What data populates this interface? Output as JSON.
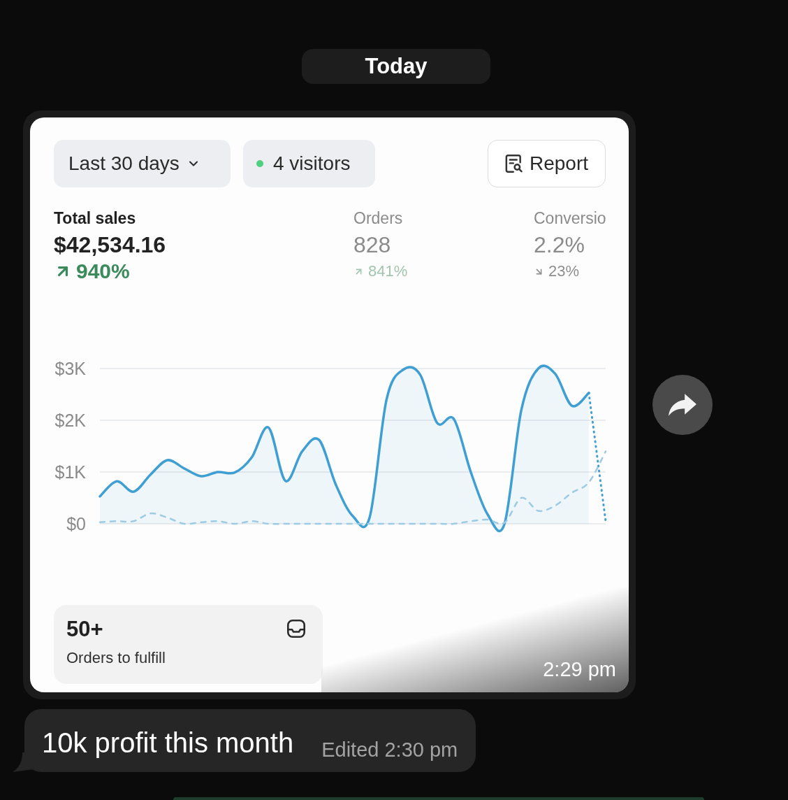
{
  "date_divider": "Today",
  "image_message": {
    "filters": [
      {
        "kind": "dropdown",
        "label": "Last 30 days"
      },
      {
        "kind": "live",
        "label": "4 visitors"
      }
    ],
    "report_button": {
      "label": "Report"
    },
    "metrics": [
      {
        "label": "Total sales",
        "value": "$42,534.16",
        "change": "940%",
        "rising": true,
        "selected": true
      },
      {
        "label": "Orders",
        "value": "828",
        "change": "841%",
        "rising": true,
        "selected": false
      },
      {
        "label": "Conversio",
        "value": "2.2%",
        "change": "23%",
        "rising": false,
        "selected": false
      }
    ],
    "chart_data": {
      "type": "line",
      "grid": true,
      "ylim": [
        0,
        3000
      ],
      "yticks": [
        {
          "value": 0,
          "label": "$0"
        },
        {
          "value": 1000,
          "label": "$1K"
        },
        {
          "value": 2000,
          "label": "$2K"
        },
        {
          "value": 3000,
          "label": "$3K"
        }
      ],
      "series": [
        {
          "type": "area",
          "color": "#3f9fd2",
          "line_style": "solid",
          "values": [
            530,
            820,
            620,
            950,
            1230,
            1070,
            920,
            1000,
            990,
            1280,
            1860,
            830,
            1400,
            1620,
            750,
            150,
            120,
            2400,
            2980,
            2880,
            1950,
            2020,
            1000,
            180,
            0,
            2200,
            3000,
            2900,
            2280,
            2530,
            null
          ]
        },
        {
          "type": "line",
          "color": "#3f9fd2",
          "line_style": "dotted",
          "values": [
            null,
            null,
            null,
            null,
            null,
            null,
            null,
            null,
            null,
            null,
            null,
            null,
            null,
            null,
            null,
            null,
            null,
            null,
            null,
            null,
            null,
            null,
            null,
            null,
            null,
            null,
            null,
            null,
            null,
            2530,
            50
          ]
        },
        {
          "type": "line",
          "color": "#9dcbe4",
          "line_style": "dashed",
          "values": [
            30,
            50,
            50,
            200,
            120,
            0,
            30,
            50,
            0,
            50,
            0,
            0,
            0,
            0,
            0,
            0,
            0,
            0,
            0,
            0,
            0,
            0,
            50,
            80,
            20,
            500,
            250,
            350,
            600,
            800,
            1400
          ]
        }
      ]
    },
    "fulfillment_card": {
      "count": "50+",
      "label": "Orders to fulfill"
    },
    "time": "2:29 pm"
  },
  "caption_message": {
    "text": "10k profit this month",
    "status": "Edited 2:30 pm"
  }
}
